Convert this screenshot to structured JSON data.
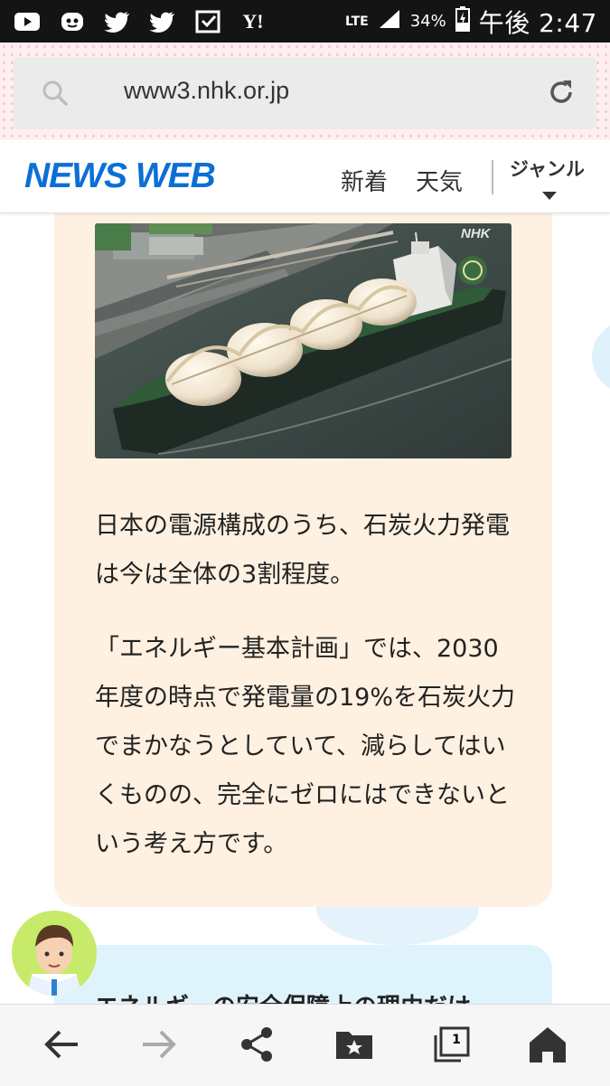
{
  "status_bar": {
    "notification_icons": [
      "youtube-icon",
      "messenger-icon",
      "twitter-icon",
      "twitter-icon",
      "news-icon",
      "yahoo-icon"
    ],
    "network": "LTE",
    "battery_percent": "34%",
    "time": "午後 2:47"
  },
  "browser": {
    "url": "www3.nhk.or.jp"
  },
  "header": {
    "logo": "NEWS WEB",
    "nav_new": "新着",
    "nav_weather": "天気",
    "nav_genre": "ジャンル"
  },
  "article": {
    "image_watermark": "NHK",
    "paragraph1": "日本の電源構成のうち、石炭火力発電は今は全体の3割程度。",
    "paragraph2": "「エネルギー基本計画」では、2030年度の時点で発電量の19%を石炭火力でまかなうとしていて、減らしてはいくものの、完全にゼロにはできないという考え方です。",
    "next_heading_partial": "エネルギーの安全保障上の理由だけ"
  },
  "bottom_bar": {
    "tab_count": "1"
  },
  "colors": {
    "logo_blue": "#0b6fd6",
    "card_bg": "#fff1e1",
    "card2_bg": "#dff3fd",
    "avatar_bg": "#c8ea6a"
  }
}
